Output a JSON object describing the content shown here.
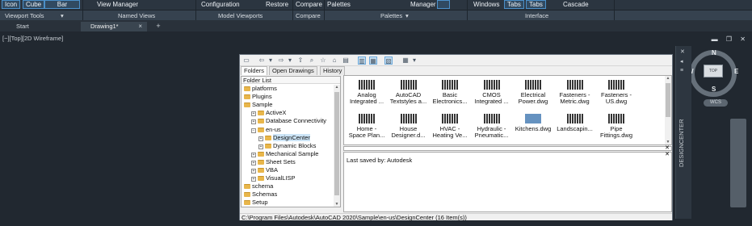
{
  "ribbon": {
    "row1": {
      "icon": "Icon",
      "cube": "Cube",
      "bar": "Bar",
      "view_manager": "View Manager",
      "configuration": "Configuration",
      "restore": "Restore",
      "compare": "Compare",
      "palettes": "Palettes",
      "manager": "Manager",
      "windows": "Windows",
      "tabs1": "Tabs",
      "tabs2": "Tabs",
      "cascade": "Cascade"
    },
    "panels": {
      "viewport_tools": "Viewport Tools",
      "named_views": "Named Views",
      "model_viewports": "Model Viewports",
      "compare": "Compare",
      "palettes": "Palettes",
      "interface": "Interface"
    }
  },
  "doc_tabs": {
    "start": "Start",
    "drawing": "Drawing1*",
    "close": "×",
    "add": "+"
  },
  "viewport": {
    "label": "[−][Top][2D Wireframe]",
    "win_ctrls": "▬ ❐ ✕"
  },
  "viewcube": {
    "north": "N",
    "south": "S",
    "east": "E",
    "west": "W",
    "top": "TOP",
    "wcs": "WCS"
  },
  "designcenter": {
    "side_title": "DESIGNCENTER",
    "tabs": [
      "Folders",
      "Open Drawings",
      "History"
    ],
    "tree_header": "Folder List",
    "tree": [
      {
        "label": "platforms",
        "indent": 0,
        "exp": ""
      },
      {
        "label": "Plugins",
        "indent": 0,
        "exp": ""
      },
      {
        "label": "Sample",
        "indent": 0,
        "exp": ""
      },
      {
        "label": "ActiveX",
        "indent": 1,
        "exp": "+"
      },
      {
        "label": "Database Connectivity",
        "indent": 1,
        "exp": "+"
      },
      {
        "label": "en-us",
        "indent": 1,
        "exp": "−"
      },
      {
        "label": "DesignCenter",
        "indent": 2,
        "exp": "+"
      },
      {
        "label": "Dynamic Blocks",
        "indent": 2,
        "exp": "+"
      },
      {
        "label": "Mechanical Sample",
        "indent": 1,
        "exp": "+"
      },
      {
        "label": "Sheet Sets",
        "indent": 1,
        "exp": "+"
      },
      {
        "label": "VBA",
        "indent": 1,
        "exp": "+"
      },
      {
        "label": "VisualLISP",
        "indent": 1,
        "exp": "+"
      },
      {
        "label": "schema",
        "indent": 0,
        "exp": ""
      },
      {
        "label": "Schemas",
        "indent": 0,
        "exp": ""
      },
      {
        "label": "Setup",
        "indent": 0,
        "exp": ""
      }
    ],
    "items": [
      [
        "Analog",
        "Integrated ..."
      ],
      [
        "AutoCAD",
        "Textstyles a..."
      ],
      [
        "Basic",
        "Electronics..."
      ],
      [
        "CMOS",
        "Integrated ..."
      ],
      [
        "Electrical",
        "Power.dwg"
      ],
      [
        "Fasteners -",
        "Metric.dwg"
      ],
      [
        "Fasteners -",
        "US.dwg"
      ],
      [
        "Home -",
        "Space Plan..."
      ],
      [
        "House",
        "Designer.d..."
      ],
      [
        "HVAC -",
        "Heating Ve..."
      ],
      [
        "Hydraulic -",
        "Pneumatic..."
      ],
      [
        "Kitchens.dwg",
        ""
      ],
      [
        "Landscapin...",
        ""
      ],
      [
        "Pipe",
        "Fittings.dwg"
      ]
    ],
    "description": "Last saved by: Autodesk",
    "status": "C:\\Program Files\\Autodesk\\AutoCAD 2020\\Sample\\en-us\\DesignCenter (16 Item(s))"
  }
}
